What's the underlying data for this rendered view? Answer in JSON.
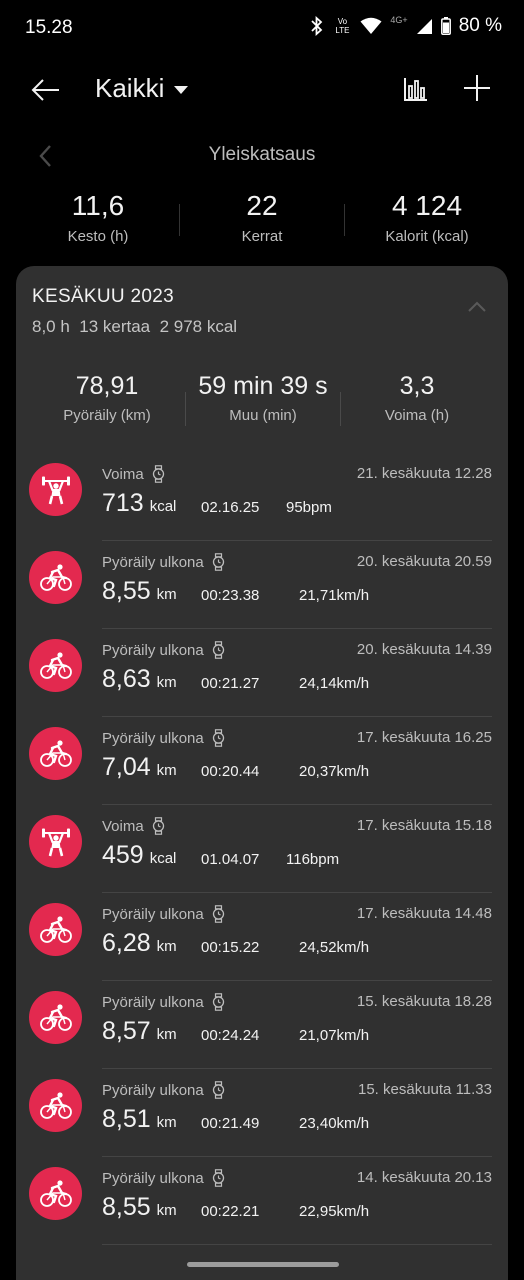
{
  "status_bar": {
    "time": "15.28",
    "network_label": "4G+",
    "volte_label": "Vo LTE",
    "battery": "80 %"
  },
  "app_bar": {
    "title": "Kaikki"
  },
  "overview": {
    "title": "Yleiskatsaus"
  },
  "totals": [
    {
      "value": "11,6",
      "label": "Kesto (h)"
    },
    {
      "value": "22",
      "label": "Kerrat"
    },
    {
      "value": "4 124",
      "label": "Kalorit (kcal)"
    }
  ],
  "month": {
    "title": "KESÄKUU 2023",
    "subtitle": "8,0 h  13 kertaa  2 978 kcal",
    "summary": [
      {
        "value": "78,91",
        "label": "Pyöräily (km)"
      },
      {
        "value": "59 min 39 s",
        "label": "Muu (min)"
      },
      {
        "value": "3,3",
        "label": "Voima (h)"
      }
    ]
  },
  "activities": [
    {
      "type": "Voima",
      "icon": "weightlifting-icon",
      "date": "21. kesäkuuta 12.28",
      "value": "713",
      "unit": "kcal",
      "duration": "02.16.25",
      "extra": "95bpm"
    },
    {
      "type": "Pyöräily ulkona",
      "icon": "cycling-icon",
      "date": "20. kesäkuuta 20.59",
      "value": "8,55",
      "unit": "km",
      "duration": "00:23.38",
      "extra": "21,71km/h"
    },
    {
      "type": "Pyöräily ulkona",
      "icon": "cycling-icon",
      "date": "20. kesäkuuta 14.39",
      "value": "8,63",
      "unit": "km",
      "duration": "00:21.27",
      "extra": "24,14km/h"
    },
    {
      "type": "Pyöräily ulkona",
      "icon": "cycling-icon",
      "date": "17. kesäkuuta 16.25",
      "value": "7,04",
      "unit": "km",
      "duration": "00:20.44",
      "extra": "20,37km/h"
    },
    {
      "type": "Voima",
      "icon": "weightlifting-icon",
      "date": "17. kesäkuuta 15.18",
      "value": "459",
      "unit": "kcal",
      "duration": "01.04.07",
      "extra": "116bpm"
    },
    {
      "type": "Pyöräily ulkona",
      "icon": "cycling-icon",
      "date": "17. kesäkuuta 14.48",
      "value": "6,28",
      "unit": "km",
      "duration": "00:15.22",
      "extra": "24,52km/h"
    },
    {
      "type": "Pyöräily ulkona",
      "icon": "cycling-icon",
      "date": "15. kesäkuuta 18.28",
      "value": "8,57",
      "unit": "km",
      "duration": "00:24.24",
      "extra": "21,07km/h"
    },
    {
      "type": "Pyöräily ulkona",
      "icon": "cycling-icon",
      "date": "15. kesäkuuta 11.33",
      "value": "8,51",
      "unit": "km",
      "duration": "00:21.49",
      "extra": "23,40km/h"
    },
    {
      "type": "Pyöräily ulkona",
      "icon": "cycling-icon",
      "date": "14. kesäkuuta 20.13",
      "value": "8,55",
      "unit": "km",
      "duration": "00:22.21",
      "extra": "22,95km/h"
    }
  ],
  "colors": {
    "accent": "#e3294f",
    "card": "#303030",
    "background": "#000000"
  }
}
